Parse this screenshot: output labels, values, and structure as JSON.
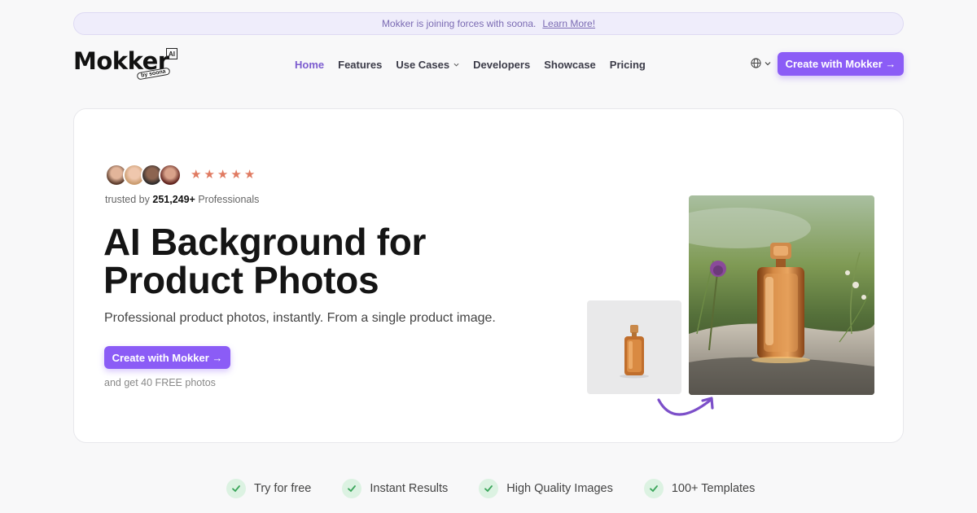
{
  "announcement": {
    "text": "Mokker is joining forces with soona.",
    "link": "Learn More!"
  },
  "brand": {
    "wordmark": "Mokker",
    "badge": "AI",
    "byline": "by soona"
  },
  "nav": {
    "items": [
      {
        "label": "Home",
        "active": true
      },
      {
        "label": "Features"
      },
      {
        "label": "Use Cases",
        "dropdown": true
      },
      {
        "label": "Developers"
      },
      {
        "label": "Showcase"
      },
      {
        "label": "Pricing"
      }
    ],
    "language_icon": "globe-icon",
    "cta": "Create with Mokker →"
  },
  "hero": {
    "rating_stars": 5,
    "trusted_prefix": "trusted by",
    "trusted_count": "251,249+",
    "trusted_suffix": "Professionals",
    "headline_line1": "AI Background for",
    "headline_line2": "Product Photos",
    "subheadline": "Professional product photos, instantly. From a single product image.",
    "cta": "Create with Mokker →",
    "cta_note": "and get 40 FREE photos"
  },
  "features": [
    "Try for free",
    "Instant Results",
    "High Quality Images",
    "100+ Templates"
  ],
  "colors": {
    "accent": "#8b5cf6",
    "star": "#e07a61",
    "check_bg": "#dcf2e2",
    "check": "#3aa55a"
  }
}
